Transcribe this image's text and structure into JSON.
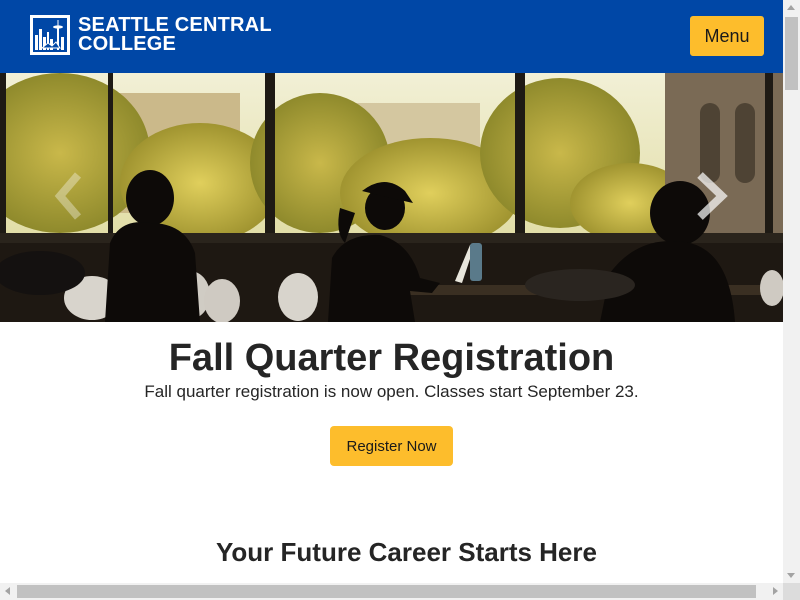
{
  "header": {
    "logo_line1": "SEATTLE CENTRAL",
    "logo_line2": "COLLEGE",
    "logo_icon": "seattle-skyline-logo",
    "menu_label": "Menu",
    "bg_color": "#0047a6",
    "accent_color": "#fdbd2c"
  },
  "hero": {
    "image": "students-studying-silhouettes-photo",
    "prev_icon": "chevron-left-icon",
    "next_icon": "chevron-right-icon"
  },
  "main": {
    "headline": "Fall Quarter Registration",
    "subtext": "Fall quarter registration is now open. Classes start September 23.",
    "cta_label": "Register Now",
    "section_title": "Your Future Career Starts Here"
  }
}
